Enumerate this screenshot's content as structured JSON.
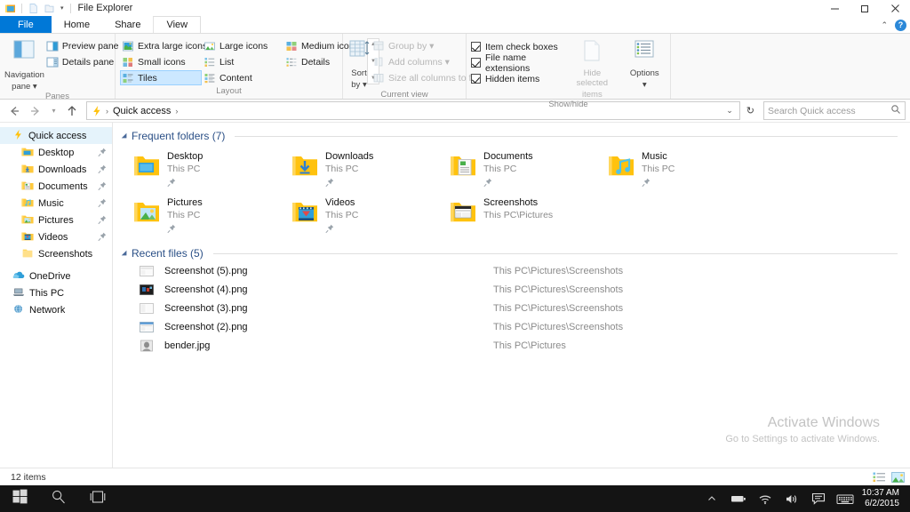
{
  "window": {
    "title": "File Explorer",
    "quick_access_toolbar": [
      "properties-icon",
      "new-folder-icon",
      "undo-icon"
    ],
    "controls": {
      "minimize": "minimize-icon",
      "maximize": "maximize-icon",
      "close": "close-icon"
    },
    "ribbon_collapse": "chevron-up-icon",
    "help": "?"
  },
  "tabs": [
    {
      "label": "File",
      "type": "file"
    },
    {
      "label": "Home",
      "type": "normal"
    },
    {
      "label": "Share",
      "type": "normal"
    },
    {
      "label": "View",
      "type": "active"
    }
  ],
  "ribbon": {
    "groups": [
      {
        "name": "Panes",
        "label": "Panes",
        "big_button": {
          "label1": "Navigation",
          "label2": "pane",
          "icon": "navigation-pane-icon",
          "has_dropdown": true
        },
        "items": [
          {
            "label": "Preview pane",
            "icon": "preview-pane-icon",
            "state": "normal"
          },
          {
            "label": "Details pane",
            "icon": "details-pane-icon",
            "state": "normal"
          }
        ]
      },
      {
        "name": "Layout",
        "label": "Layout",
        "columns": [
          [
            {
              "label": "Extra large icons",
              "icon": "extra-large-icons-icon",
              "state": "normal"
            },
            {
              "label": "Small icons",
              "icon": "small-icons-icon",
              "state": "normal"
            },
            {
              "label": "Tiles",
              "icon": "tiles-icon",
              "state": "selected"
            }
          ],
          [
            {
              "label": "Large icons",
              "icon": "large-icons-icon",
              "state": "normal"
            },
            {
              "label": "List",
              "icon": "list-icon",
              "state": "normal"
            },
            {
              "label": "Content",
              "icon": "content-icon",
              "state": "normal"
            }
          ],
          [
            {
              "label": "Medium icons",
              "icon": "medium-icons-icon",
              "state": "normal"
            },
            {
              "label": "Details",
              "icon": "details-icon",
              "state": "normal"
            }
          ]
        ],
        "scroll": [
          "scroll-up-icon",
          "scroll-down-icon",
          "more-icon"
        ]
      },
      {
        "name": "Current view",
        "label": "Current view",
        "big_button": {
          "label1": "Sort",
          "label2": "by",
          "icon": "sort-by-icon",
          "has_dropdown": true
        },
        "items": [
          {
            "label": "Group by",
            "icon": "group-by-icon",
            "state": "disabled",
            "has_dropdown": true
          },
          {
            "label": "Add columns",
            "icon": "add-columns-icon",
            "state": "disabled",
            "has_dropdown": true
          },
          {
            "label": "Size all columns to fit",
            "icon": "size-columns-icon",
            "state": "disabled"
          }
        ]
      },
      {
        "name": "Show/hide",
        "label": "Show/hide",
        "checkboxes": [
          {
            "label": "Item check boxes",
            "checked": true
          },
          {
            "label": "File name extensions",
            "checked": true
          },
          {
            "label": "Hidden items",
            "checked": true
          }
        ],
        "big_buttons": [
          {
            "label1": "Hide selected",
            "label2": "items",
            "icon": "hide-selected-items-icon",
            "state": "disabled"
          },
          {
            "label1": "Options",
            "label2": "",
            "icon": "options-icon",
            "state": "normal",
            "has_dropdown": true
          }
        ]
      }
    ]
  },
  "addressbar": {
    "back": "back-arrow-icon",
    "forward": "forward-arrow-icon",
    "recent": "chevron-down-icon",
    "up": "up-arrow-icon",
    "location_icon": "quick-access-lightning-icon",
    "breadcrumbs": [
      "Quick access"
    ],
    "dropdown": "chevron-down-icon",
    "refresh": "refresh-icon",
    "search": {
      "placeholder": "Search Quick access",
      "icon": "search-icon",
      "value": ""
    }
  },
  "sidebar": {
    "items": [
      {
        "label": "Quick access",
        "icon": "quick-access-lightning-icon",
        "level": "root",
        "selected": true,
        "pinned": false
      },
      {
        "label": "Desktop",
        "icon": "desktop-folder-icon",
        "level": "child",
        "selected": false,
        "pinned": true
      },
      {
        "label": "Downloads",
        "icon": "downloads-folder-icon",
        "level": "child",
        "selected": false,
        "pinned": true
      },
      {
        "label": "Documents",
        "icon": "documents-folder-icon",
        "level": "child",
        "selected": false,
        "pinned": true
      },
      {
        "label": "Music",
        "icon": "music-folder-icon",
        "level": "child",
        "selected": false,
        "pinned": true
      },
      {
        "label": "Pictures",
        "icon": "pictures-folder-icon",
        "level": "child",
        "selected": false,
        "pinned": true
      },
      {
        "label": "Videos",
        "icon": "videos-folder-icon",
        "level": "child",
        "selected": false,
        "pinned": true
      },
      {
        "label": "Screenshots",
        "icon": "plain-folder-icon",
        "level": "child",
        "selected": false,
        "pinned": false
      },
      {
        "label": "OneDrive",
        "icon": "onedrive-cloud-icon",
        "level": "root",
        "selected": false,
        "pinned": false
      },
      {
        "label": "This PC",
        "icon": "this-pc-icon",
        "level": "root",
        "selected": false,
        "pinned": false
      },
      {
        "label": "Network",
        "icon": "network-globe-icon",
        "level": "root",
        "selected": false,
        "pinned": false
      }
    ]
  },
  "content": {
    "frequent_folders": {
      "title": "Frequent folders (7)",
      "items": [
        {
          "name": "Desktop",
          "location": "This PC",
          "icon": "desktop-folder-icon",
          "pinned": true
        },
        {
          "name": "Downloads",
          "location": "This PC",
          "icon": "downloads-folder-icon",
          "pinned": true
        },
        {
          "name": "Documents",
          "location": "This PC",
          "icon": "documents-folder-icon",
          "pinned": true
        },
        {
          "name": "Music",
          "location": "This PC",
          "icon": "music-folder-icon",
          "pinned": true
        },
        {
          "name": "Pictures",
          "location": "This PC",
          "icon": "pictures-folder-icon",
          "pinned": true
        },
        {
          "name": "Videos",
          "location": "This PC",
          "icon": "videos-folder-icon",
          "pinned": true
        },
        {
          "name": "Screenshots",
          "location": "This PC\\Pictures",
          "icon": "screenshots-folder-icon",
          "pinned": false
        }
      ]
    },
    "recent_files": {
      "title": "Recent files (5)",
      "items": [
        {
          "name": "Screenshot (5).png",
          "path": "This PC\\Pictures\\Screenshots",
          "icon": "image-thumb-light-icon"
        },
        {
          "name": "Screenshot (4).png",
          "path": "This PC\\Pictures\\Screenshots",
          "icon": "image-thumb-dark-icon"
        },
        {
          "name": "Screenshot (3).png",
          "path": "This PC\\Pictures\\Screenshots",
          "icon": "image-thumb-light-icon"
        },
        {
          "name": "Screenshot (2).png",
          "path": "This PC\\Pictures\\Screenshots",
          "icon": "image-thumb-window-icon"
        },
        {
          "name": "bender.jpg",
          "path": "This PC\\Pictures",
          "icon": "image-thumb-photo-icon"
        }
      ]
    },
    "watermark": {
      "line1": "Activate Windows",
      "line2": "Go to Settings to activate Windows."
    }
  },
  "statusbar": {
    "item_count": "12 items",
    "view_buttons": [
      "details-view-icon",
      "large-icons-view-icon"
    ]
  },
  "taskbar": {
    "start": "windows-start-icon",
    "search": "search-icon",
    "taskview": "task-view-icon",
    "tray": [
      "show-hidden-icons-icon",
      "battery-icon",
      "wifi-icon",
      "volume-icon",
      "action-center-icon",
      "keyboard-icon"
    ],
    "clock": {
      "time": "10:37 AM",
      "date": "6/2/2015"
    }
  },
  "colors": {
    "accent": "#0078d7",
    "folder_yellow": "#ffc20e",
    "folder_light": "#ffd75e",
    "section_heading": "#2a4f86",
    "selection": "#cce8ff",
    "taskbar": "#141414"
  }
}
